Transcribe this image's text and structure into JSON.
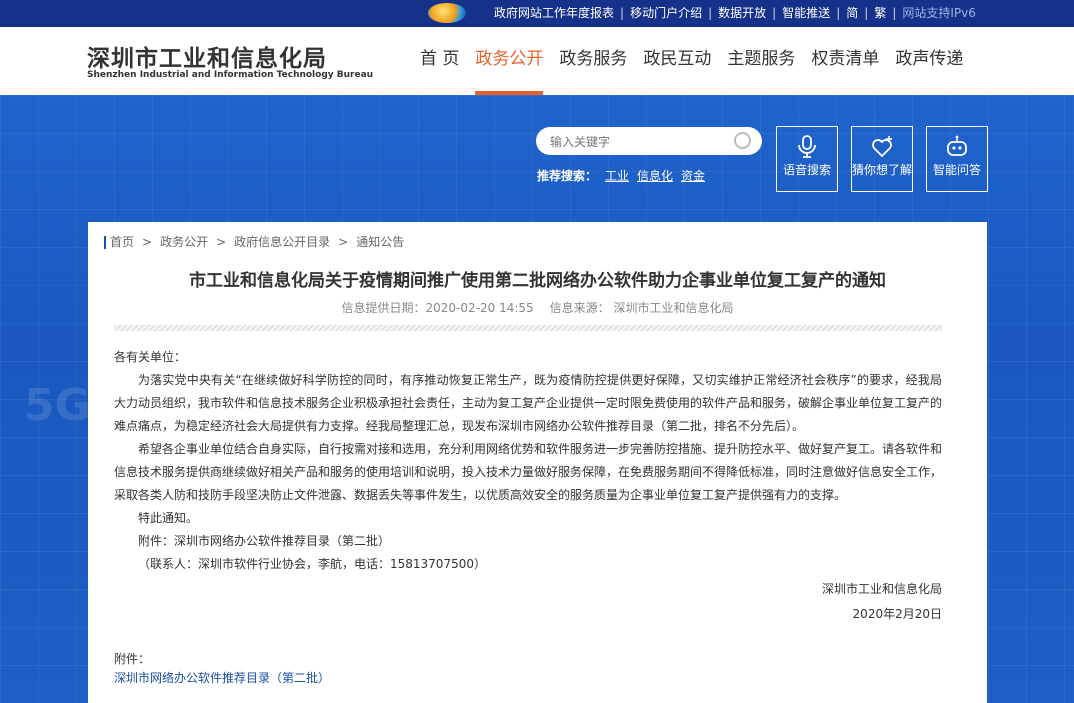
{
  "topbar": {
    "links": [
      "政府网站工作年度报表",
      "移动门户介绍",
      "数据开放",
      "智能推送",
      "简",
      "繁"
    ],
    "ipv6": "网站支持IPv6"
  },
  "header": {
    "title_cn": "深圳市工业和信息化局",
    "title_en": "Shenzhen Industrial and Information Technology Bureau",
    "nav": [
      "首 页",
      "政务公开",
      "政务服务",
      "政民互动",
      "主题服务",
      "权责清单",
      "政声传递"
    ],
    "active_nav": "政务公开"
  },
  "search": {
    "placeholder": "输入关键字",
    "hot_label": "推荐搜索：",
    "hot_words": [
      "工业",
      "信息化",
      "资金"
    ]
  },
  "tools": [
    {
      "label": "语音搜索",
      "icon": "microphone-icon"
    },
    {
      "label": "猜你想了解",
      "icon": "heart-plus-icon"
    },
    {
      "label": "智能问答",
      "icon": "robot-icon"
    }
  ],
  "breadcrumb": [
    "首页",
    "政务公开",
    "政府信息公开目录",
    "通知公告"
  ],
  "article": {
    "title": "市工业和信息化局关于疫情期间推广使用第二批网络办公软件助力企事业单位复工复产的通知",
    "date_label": "信息提供日期：2020-02-20 14:55",
    "source_label": "信息来源： 深圳市工业和信息化局",
    "salutation": "各有关单位：",
    "p1": "为落实党中央有关“在继续做好科学防控的同时，有序推动恢复正常生产，既为疫情防控提供更好保障，又切实维护正常经济社会秩序”的要求，经我局大力动员组织，我市软件和信息技术服务企业积极承担社会责任，主动为复工复产企业提供一定时限免费使用的软件产品和服务，破解企事业单位复工复产的难点痛点，为稳定经济社会大局提供有力支撑。经我局整理汇总，现发布深圳市网络办公软件推荐目录（第二批，排名不分先后）。",
    "p2": "希望各企事业单位结合自身实际，自行按需对接和选用，充分利用网络优势和软件服务进一步完善防控措施、提升防控水平、做好复产复工。请各软件和信息技术服务提供商继续做好相关产品和服务的使用培训和说明，投入技术力量做好服务保障，在免费服务期间不得降低标准，同时注意做好信息安全工作，采取各类人防和技防手段坚决防止文件泄露、数据丢失等事件发生，以优质高效安全的服务质量为企事业单位复工复产提供强有力的支撑。",
    "p3": "特此通知。",
    "p4": "附件：深圳市网络办公软件推荐目录（第二批）",
    "p5": "（联系人：深圳市软件行业协会，李航，电话：15813707500）",
    "signature": "深圳市工业和信息化局",
    "sign_date": "2020年2月20日",
    "attach_label": "附件：",
    "attach_link": "深圳市网络办公软件推荐目录（第二批）"
  },
  "colors": {
    "accent": "#e8612a",
    "banner": "#1d5fc4",
    "topbar": "#15318a",
    "link": "#1a4fa8"
  }
}
